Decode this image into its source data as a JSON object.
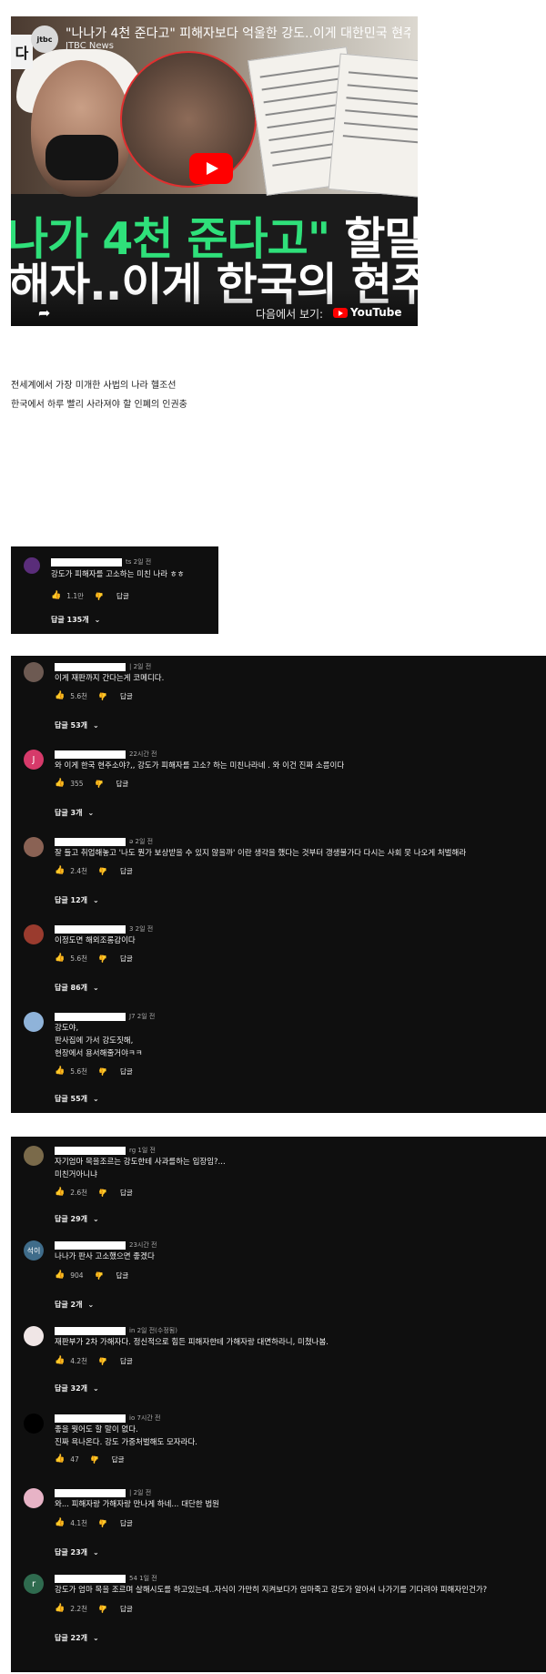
{
  "video": {
    "badge": "다",
    "channel_logo": "jtbc",
    "title": "\"나나가 4천 준다고\" 피해자보다 억울한 강도..이게 대한민국 현주",
    "channel": "JTBC News",
    "caption_line1_green": "나가 4천 준다고\"",
    "caption_line1_white": " 할말 많",
    "caption_line2": "해자..이게 한국의 현주",
    "watch_on": "다음에서 보기:",
    "youtube": "YouTube",
    "play_icon": "play-icon",
    "share_icon": "share-icon"
  },
  "body": {
    "line1": "전세계에서 가장 미개한 사법의 나라 헬조선",
    "line2": "한국에서 하루 빨리 사라져야 할 인폐의 인권충"
  },
  "panel1": {
    "comments": [
      {
        "meta": "ts 2일 전",
        "text": "강도가 피해자를 고소하는 미친 나라 ㅎㅎ",
        "likes": "1.1만",
        "reply_label": "답글",
        "replies": "답글 135개"
      }
    ]
  },
  "panel2": {
    "comments": [
      {
        "avatar": "",
        "meta": "| 2일 전",
        "text": "이게 재판까지 간다는게 코메디다.",
        "likes": "5.6천",
        "reply_label": "답글",
        "replies": "답글 53개"
      },
      {
        "avatar": "J",
        "meta": "22시간 전",
        "text": "와 이게 한국 현주소야?,, 강도가 피해자를 고소? 하는 미친나라네 . 와 이건 진짜 소름이다",
        "likes": "355",
        "reply_label": "답글",
        "replies": "답글 3개"
      },
      {
        "avatar": "",
        "meta": "ə 2일 전",
        "text": "잘 들고 취업해놓고 '나도 뭔가 보상받을 수 있지 않을까' 이란 생각을 했다는 것부터 갱생불가다 다시는 사회 못 나오게 처벌해라",
        "likes": "2.4천",
        "reply_label": "답글",
        "replies": "답글 12개"
      },
      {
        "avatar": "",
        "meta": "3 2일 전",
        "text": "이정도면 해외조롱감이다",
        "likes": "5.6천",
        "reply_label": "답글",
        "replies": "답글 86개"
      },
      {
        "avatar": "",
        "meta": "J7 2일 전",
        "text": "강도야,\n판사집에 가서 강도짓해,\n현장에서 용서해줄거야ㅋㅋ",
        "likes": "5.6천",
        "reply_label": "답글",
        "replies": "답글 55개"
      }
    ]
  },
  "panel3": {
    "comments": [
      {
        "avatar": "",
        "meta": "rg 1일 전",
        "text": "자기엄마 목을조르는 강도한테 사과를하는 입장임?...\n미친거아니냐",
        "likes": "2.6천",
        "reply_label": "답글",
        "replies": "답글 29개"
      },
      {
        "avatar": "석이",
        "meta": "23시간 전",
        "text": "나나가 판사 고소했으면 좋겠다",
        "likes": "904",
        "reply_label": "답글",
        "replies": "답글 2개"
      },
      {
        "avatar": "",
        "meta": "in 2일 전(수정됨)",
        "text": "재판부가 2차 가해자다. 정신적으로 힘든 피해자한테 가해자랑 대면하라니, 미쳤나봄.",
        "likes": "4.2천",
        "reply_label": "답글",
        "replies": "답글 32개"
      },
      {
        "avatar": "",
        "meta": "io 7시간 전",
        "text": "좋을 뭣어도 할 말이 없다.\n진짜 욕나온다. 강도 가중처벌해도 모자라다.",
        "likes": "47",
        "reply_label": "답글",
        "replies": ""
      },
      {
        "avatar": "",
        "meta": "| 2일 전",
        "text": "와... 피해자랑 가해자랑 만나게 하네... 대단한 법원",
        "likes": "4.1천",
        "reply_label": "답글",
        "replies": "답글 23개"
      },
      {
        "avatar": "r",
        "meta": "54 1일 전",
        "text": "강도가 엄마 목을 조르며 살해시도를 하고있는데..자식이 가만히 지켜보다가 엄마죽고 강도가 알아서 나가기를 기다려야 피해자인건가?",
        "likes": "2.2천",
        "reply_label": "답글",
        "replies": "답글 22개"
      }
    ]
  },
  "icons": {
    "like": "thumbs-up-icon",
    "dislike": "thumbs-down-icon",
    "chevron": "chevron-down-icon"
  },
  "colors": {
    "panel_bg": "#0f0f0f",
    "caption_green": "#2fe07a",
    "youtube_red": "#ff0000"
  }
}
